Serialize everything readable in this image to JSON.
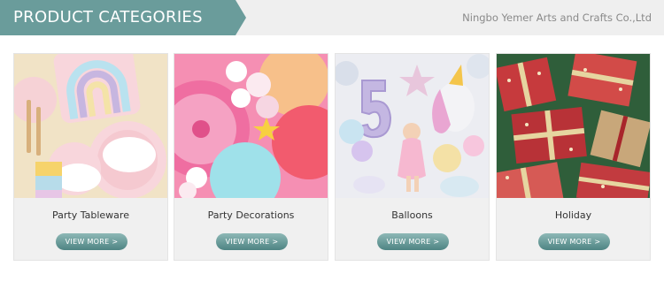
{
  "header": {
    "title": "PRODUCT CATEGORIES",
    "company": "Ningbo Yemer Arts and Crafts Co.,Ltd"
  },
  "categories": [
    {
      "label": "Party Tableware",
      "button": "VIEW MORE >",
      "image": "rainbow-plates-and-cups"
    },
    {
      "label": "Party Decorations",
      "button": "VIEW MORE >",
      "image": "paper-fans-and-pompoms"
    },
    {
      "label": "Balloons",
      "button": "VIEW MORE >",
      "image": "unicorn-and-number-5-balloons"
    },
    {
      "label": "Holiday",
      "button": "VIEW MORE >",
      "image": "wrapped-christmas-gifts"
    }
  ],
  "colors": {
    "accent": "#6a9c9b",
    "button": "#5f9392",
    "topbar": "#efefef"
  }
}
